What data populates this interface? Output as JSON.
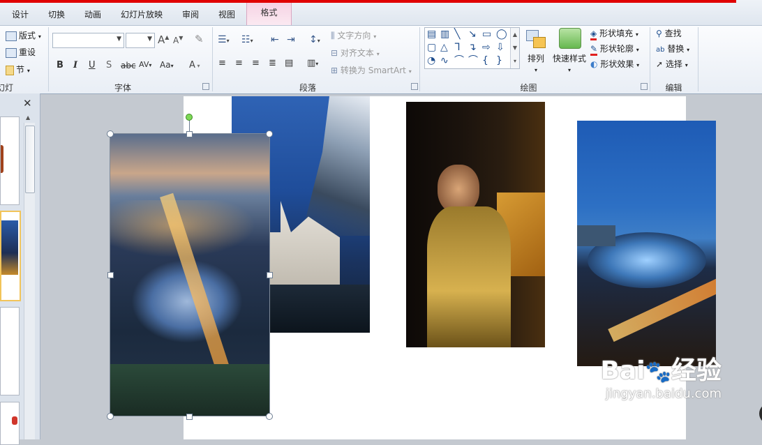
{
  "tabs": [
    {
      "label": "设计"
    },
    {
      "label": "切换"
    },
    {
      "label": "动画"
    },
    {
      "label": "幻灯片放映"
    },
    {
      "label": "审阅"
    },
    {
      "label": "视图"
    },
    {
      "label": "格式"
    }
  ],
  "ribbon": {
    "slides": {
      "layout": "版式",
      "reset": "重设",
      "section": "节",
      "group_label": "幻灯片"
    },
    "font": {
      "group_label": "字体",
      "font_name": "",
      "font_size": "",
      "grow": "A",
      "shrink": "A",
      "bold": "B",
      "italic": "I",
      "underline": "U",
      "shadow": "S",
      "strike": "abc",
      "spacing": "AV",
      "case": "Aa",
      "color": "A"
    },
    "paragraph": {
      "group_label": "段落",
      "text_direction": "文字方向",
      "align_text": "对齐文本",
      "convert_smartart": "转换为 SmartArt"
    },
    "drawing": {
      "group_label": "绘图",
      "arrange": "排列",
      "quick_styles": "快速样式",
      "shape_fill": "形状填充",
      "shape_outline": "形状轮廓",
      "shape_effects": "形状效果"
    },
    "editing": {
      "group_label": "编辑",
      "find": "查找",
      "replace": "替换",
      "select": "选择"
    }
  },
  "watermark": {
    "brand": "Bai",
    "brand2": "经验",
    "url": "jingyan.baidu.com"
  },
  "colors": {
    "accent_red": "#e00000",
    "format_tab": "#f6d3e4",
    "selection_border": "#f2c45a"
  }
}
